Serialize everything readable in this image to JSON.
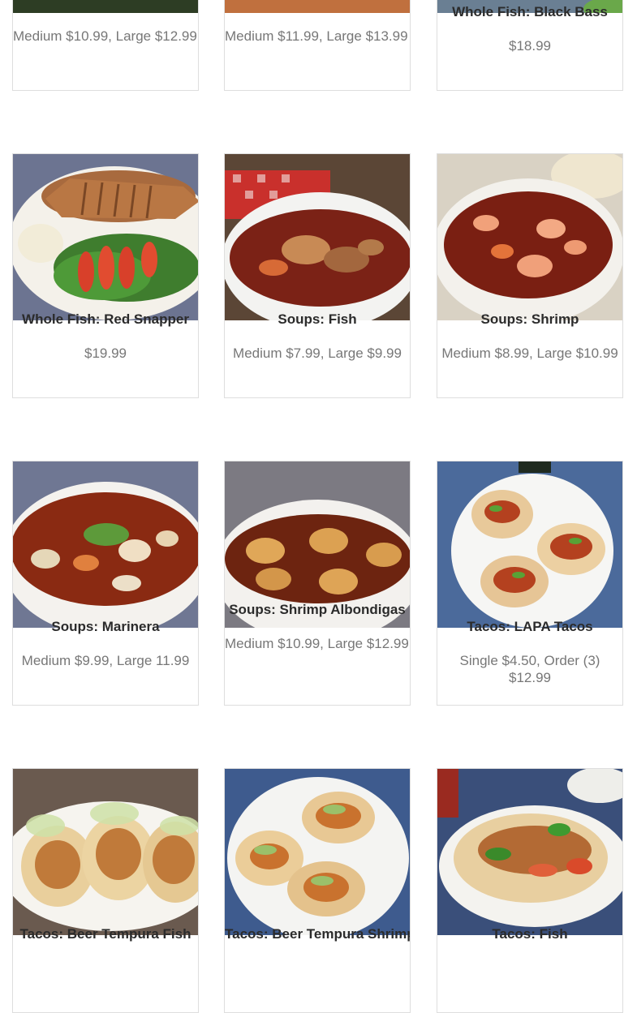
{
  "items": [
    {
      "title": "",
      "price": "Medium $10.99, Large $12.99"
    },
    {
      "title": "",
      "price": "Medium $11.99, Large $13.99"
    },
    {
      "title": "Whole Fish: Black Bass",
      "price": "$18.99"
    },
    {
      "title": "Whole Fish: Red Snapper",
      "price": "$19.99",
      "image": "fried-red-snapper-plate"
    },
    {
      "title": "Soups: Fish",
      "price": "Medium $7.99, Large $9.99",
      "image": "fish-soup-bowl"
    },
    {
      "title": "Soups: Shrimp",
      "price": "Medium $8.99, Large $10.99",
      "image": "shrimp-soup-bowl"
    },
    {
      "title": "Soups: Marinera",
      "price": "Medium $9.99, Large 11.99",
      "image": "marinera-soup-bowl"
    },
    {
      "title": "Soups: Shrimp Albondigas",
      "price": "Medium $10.99, Large $12.99",
      "image": "albondigas-soup-bowl"
    },
    {
      "title": "Tacos: LAPA Tacos",
      "price": "Single $4.50, Order (3) $12.99",
      "image": "lapa-tacos-plate"
    },
    {
      "title": "Tacos: Beer Tempura Fish",
      "price": "",
      "image": "tempura-fish-tacos"
    },
    {
      "title": "Tacos: Beer Tempura Shrimp",
      "price": "",
      "image": "tempura-shrimp-tacos"
    },
    {
      "title": "Tacos: Fish",
      "price": "",
      "image": "fish-tacos-plate"
    }
  ]
}
